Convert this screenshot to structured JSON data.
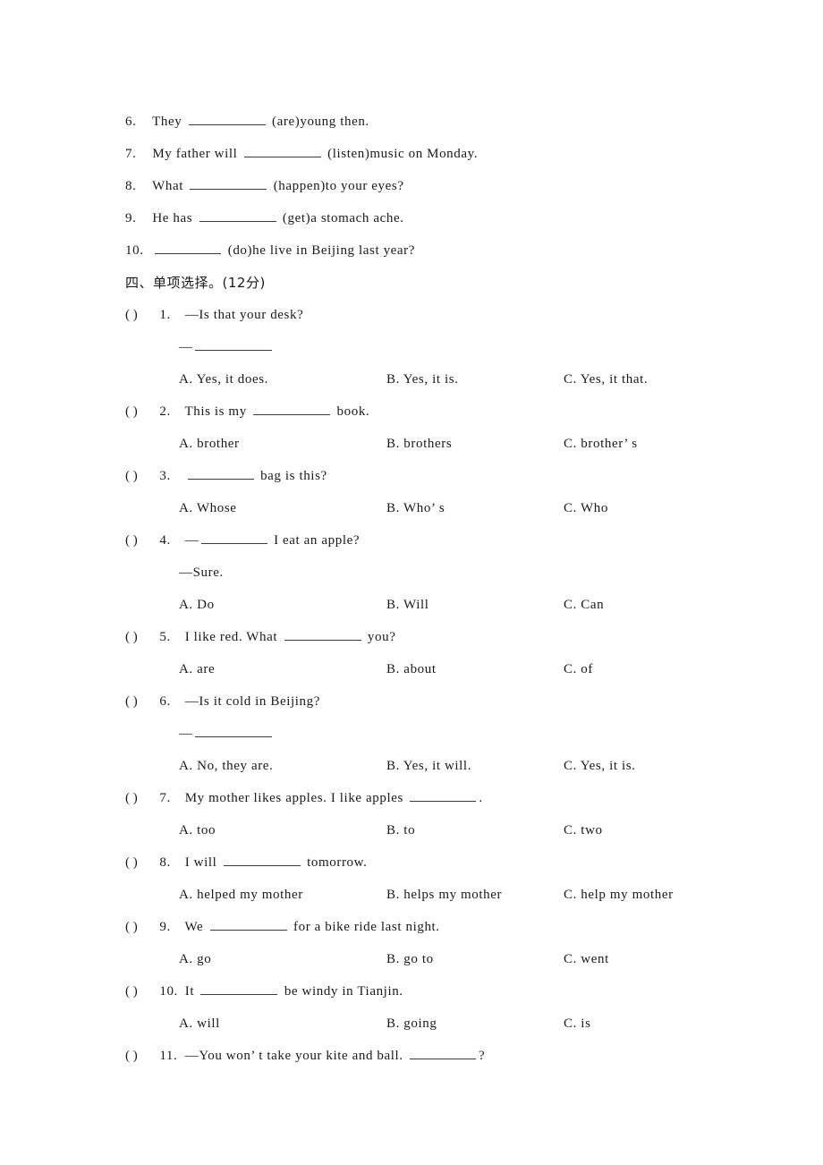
{
  "document": {
    "type": "english-exam-worksheet",
    "language": "zh-CN"
  },
  "fill_in_section": {
    "items": [
      {
        "number": "6.",
        "before": "They",
        "after": "(are)young then."
      },
      {
        "number": "7.",
        "before": "My father will",
        "after": "(listen)music on Monday."
      },
      {
        "number": "8.",
        "before": "What",
        "after": "(happen)to your eyes?"
      },
      {
        "number": "9.",
        "before": "He has",
        "after": "(get)a stomach ache."
      },
      {
        "number": "10.",
        "before": "",
        "after": "(do)he live in Beijing last year?"
      }
    ]
  },
  "choice_section": {
    "heading": "四、单项选择。(12分)",
    "bracket": "(  )",
    "questions": [
      {
        "number": "1.",
        "stem": "—Is that your desk?",
        "continuation": "—",
        "continuation_has_blank": true,
        "options": {
          "a": "A. Yes, it does.",
          "b": "B. Yes, it is.",
          "c": "C. Yes, it that."
        }
      },
      {
        "number": "2.",
        "stem_before": "This is my",
        "stem_after": "book.",
        "options": {
          "a": "A. brother",
          "b": "B. brothers",
          "c": "C. brother’ s"
        }
      },
      {
        "number": "3.",
        "stem_before": "",
        "stem_after": "bag is this?",
        "options": {
          "a": "A. Whose",
          "b": "B. Who’ s",
          "c": "C. Who"
        }
      },
      {
        "number": "4.",
        "stem_before": "—",
        "stem_after": "I eat an apple?",
        "continuation": "—Sure.",
        "continuation_has_blank": false,
        "options": {
          "a": "A. Do",
          "b": "B. Will",
          "c": "C. Can"
        }
      },
      {
        "number": "5.",
        "stem_before": "I like red. What",
        "stem_after": "you?",
        "options": {
          "a": "A. are",
          "b": "B. about",
          "c": "C. of"
        }
      },
      {
        "number": "6.",
        "stem": "—Is it cold in Beijing?",
        "continuation": "—",
        "continuation_has_blank": true,
        "options": {
          "a": "A. No, they are.",
          "b": "B. Yes, it will.",
          "c": "C. Yes, it is."
        }
      },
      {
        "number": "7.",
        "stem_before": "My mother likes apples. I like apples",
        "stem_after": ".",
        "options": {
          "a": "A. too",
          "b": "B. to",
          "c": "C. two"
        }
      },
      {
        "number": "8.",
        "stem_before": "I will",
        "stem_after": "tomorrow.",
        "options": {
          "a": "A. helped my mother",
          "b": "B. helps my mother",
          "c": "C. help my mother"
        }
      },
      {
        "number": "9.",
        "stem_before": "We",
        "stem_after": "for a bike ride last night.",
        "options": {
          "a": "A. go",
          "b": "B. go to",
          "c": "C. went"
        }
      },
      {
        "number": "10.",
        "stem_before": "It",
        "stem_after": "be windy in Tianjin.",
        "options": {
          "a": "A. will",
          "b": "B. going",
          "c": "C. is"
        }
      },
      {
        "number": "11.",
        "stem_before": "—You won’ t take your kite and ball.",
        "stem_after": "?"
      }
    ]
  }
}
